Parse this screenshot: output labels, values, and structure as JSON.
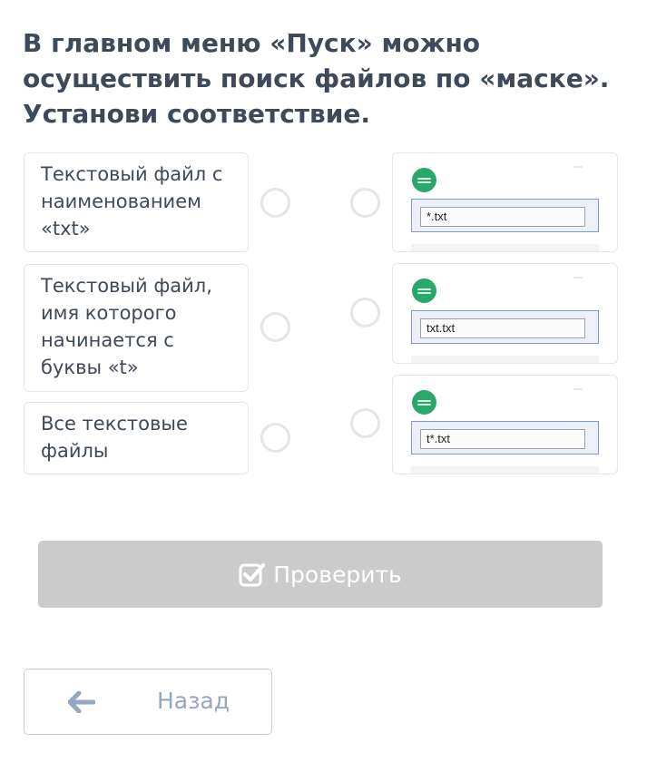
{
  "question": "В главном меню «Пуск» можно осуществить поиск файлов по «маске». Установи соответствие.",
  "left_items": [
    "Текстовый файл с наименованием «txt»",
    "Текстовый файл, имя которого начинается с буквы «t»",
    "Все текстовые файлы"
  ],
  "right_items": [
    "*.txt",
    "txt.txt",
    "t*.txt"
  ],
  "right_logo_icon": "bilimland-logo-icon",
  "buttons": {
    "check": "Проверить",
    "check_icon": "checkbox-check-icon",
    "back": "Назад",
    "back_icon": "arrow-left-icon"
  },
  "colors": {
    "text": "#3e4a59",
    "check_button_bg": "#cbcbcb",
    "logo_green": "#2aa86c",
    "back_label": "#93a7bd"
  }
}
